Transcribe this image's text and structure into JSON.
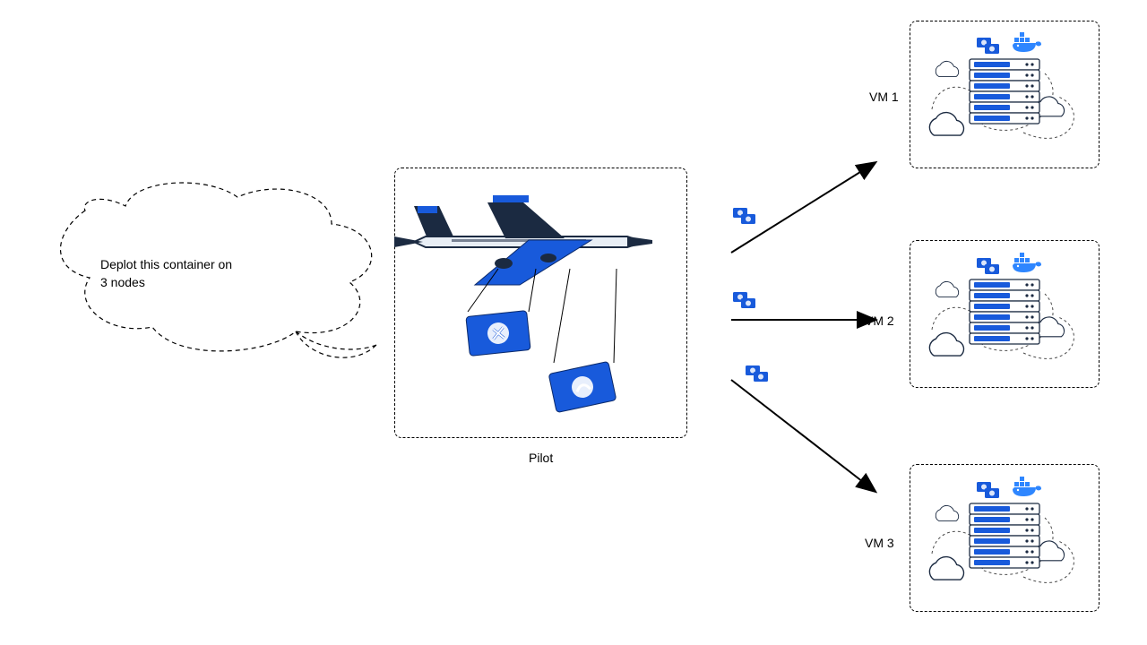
{
  "speech": {
    "line1": "Deplot this container on",
    "line2": "3 nodes"
  },
  "pilot": {
    "label": "Pilot"
  },
  "vms": [
    {
      "label": "VM 1"
    },
    {
      "label": "VM 2"
    },
    {
      "label": "VM 3"
    }
  ],
  "colors": {
    "blue": "#185ADB",
    "lightblue": "#2E86FF",
    "dark": "#1b2a41",
    "outline": "#000000"
  }
}
